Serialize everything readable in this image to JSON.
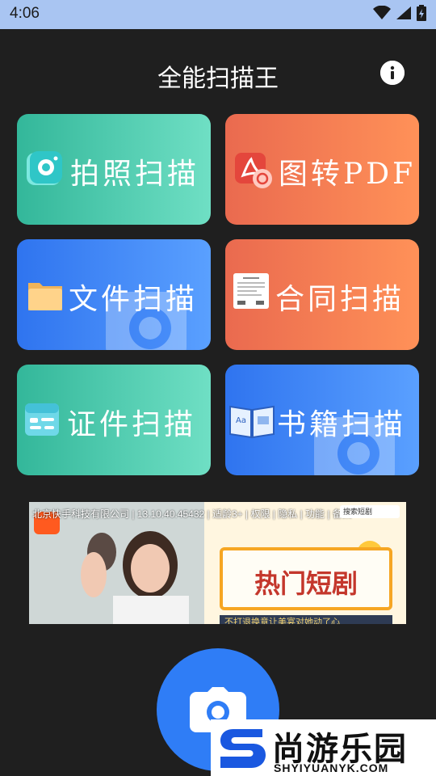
{
  "status_bar": {
    "time": "4:06"
  },
  "header": {
    "title": "全能扫描王"
  },
  "tiles": [
    {
      "label": "拍照扫描",
      "icon": "camera-icon"
    },
    {
      "label": "图转PDF",
      "icon": "pdf-icon"
    },
    {
      "label": "文件扫描",
      "icon": "folder-icon"
    },
    {
      "label": "合同扫描",
      "icon": "contract-icon"
    },
    {
      "label": "证件扫描",
      "icon": "id-card-icon"
    },
    {
      "label": "书籍扫描",
      "icon": "book-icon"
    }
  ],
  "ad": {
    "meta": "北京快手科技有限公司 | 13.10.40.45432 | 适龄3+ | 权限 | 隐私 | 功能 | 备案",
    "search_placeholder": "搜索短剧",
    "headline": "热门短剧",
    "strip_text": "不打退换意让美宴对她动了心"
  },
  "watermark": {
    "brand": "尚游乐园",
    "url": "SHYIYUANYK.COM"
  },
  "colors": {
    "background": "#1f1f1f",
    "status_bar": "#a9c5f2",
    "green_tile": "#33b79a",
    "orange_tile": "#ea6a4f",
    "blue_tile": "#2f74ef",
    "fab": "#2f7df6"
  }
}
